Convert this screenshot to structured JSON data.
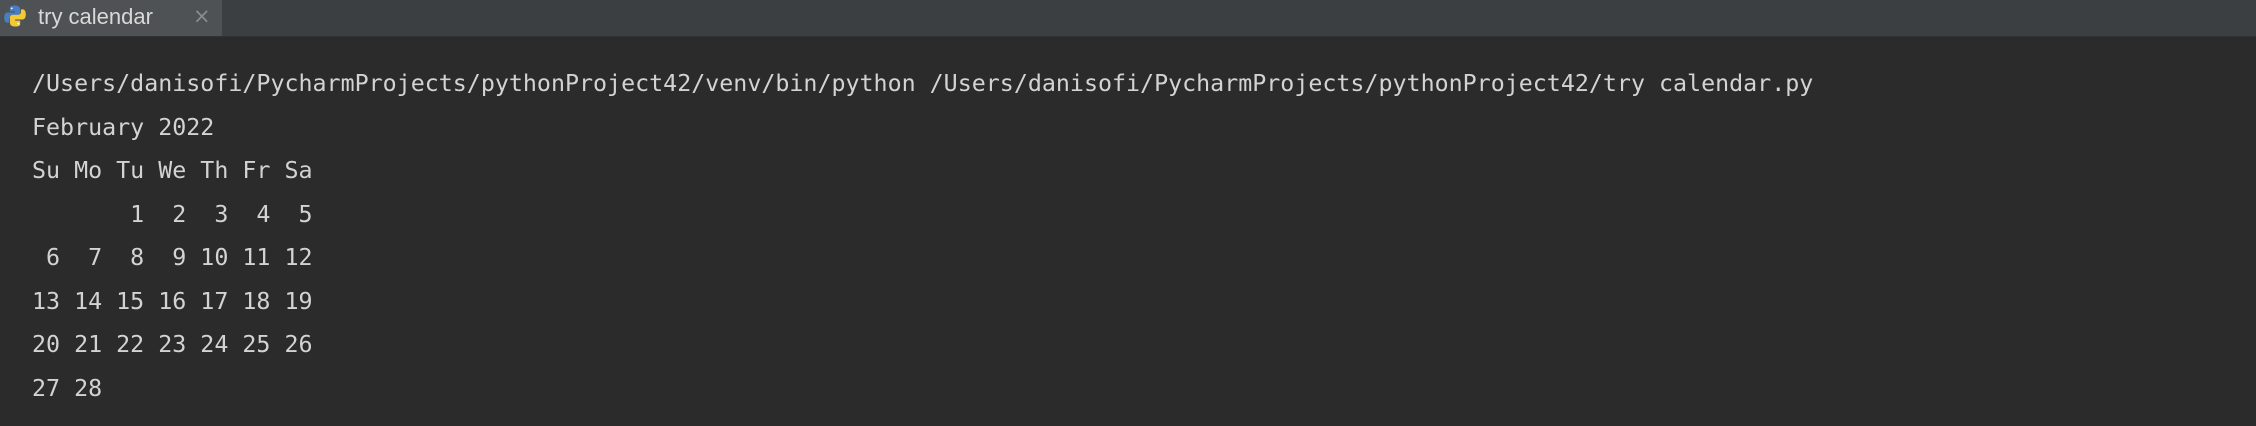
{
  "tab": {
    "icon": "python-file-icon",
    "title": "try calendar",
    "close_glyph": "×"
  },
  "console": {
    "lines": [
      "/Users/danisofi/PycharmProjects/pythonProject42/venv/bin/python /Users/danisofi/PycharmProjects/pythonProject42/try calendar.py",
      "February 2022",
      "Su Mo Tu We Th Fr Sa",
      "       1  2  3  4  5",
      " 6  7  8  9 10 11 12",
      "13 14 15 16 17 18 19",
      "20 21 22 23 24 25 26",
      "27 28"
    ]
  },
  "colors": {
    "background": "#2b2b2b",
    "tabbar": "#3c3f41",
    "active_tab": "#4e5254",
    "text": "#d3d3d3"
  }
}
